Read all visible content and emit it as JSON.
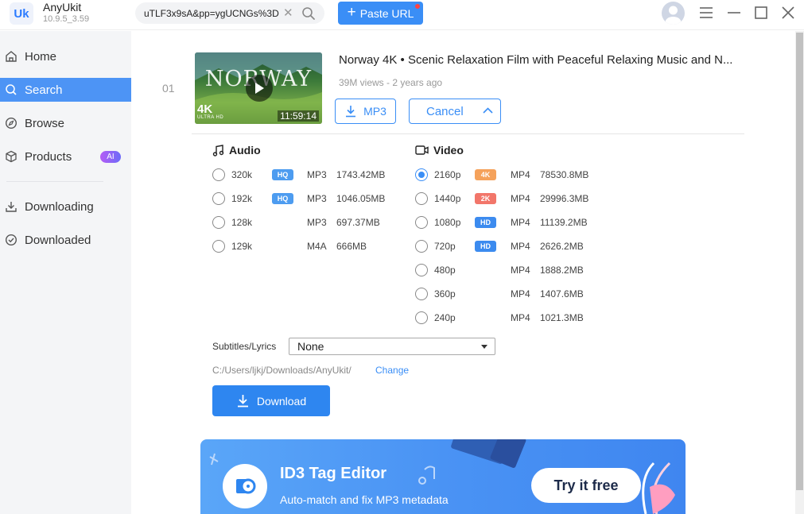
{
  "app": {
    "name": "AnyUkit",
    "version": "10.9.5_3.59",
    "logo_text": "Uk"
  },
  "toolbar": {
    "url_value": "uTLF3x9sA&pp=ygUCNGs%3D",
    "paste_label": "Paste URL"
  },
  "sidebar": {
    "items": [
      {
        "label": "Home",
        "icon": "home-icon"
      },
      {
        "label": "Search",
        "icon": "search-icon",
        "active": true
      },
      {
        "label": "Browse",
        "icon": "compass-icon"
      },
      {
        "label": "Products",
        "icon": "box-icon",
        "badge": "AI"
      },
      {
        "label": "Downloading",
        "icon": "download-icon"
      },
      {
        "label": "Downloaded",
        "icon": "check-circle-icon"
      }
    ]
  },
  "result": {
    "index": "01",
    "thumbnail": {
      "overlay_title": "NORWAY",
      "badge": "4K",
      "badge_sub": "ULTRA HD",
      "duration": "11:59:14"
    },
    "title": "Norway 4K • Scenic Relaxation Film with Peaceful Relaxing Music and N...",
    "meta": "39M views - 2 years ago",
    "mp3_label": "MP3",
    "cancel_label": "Cancel"
  },
  "audio": {
    "title": "Audio",
    "options": [
      {
        "quality": "320k",
        "badge": "HQ",
        "format": "MP3",
        "size": "1743.42MB",
        "checked": false
      },
      {
        "quality": "192k",
        "badge": "HQ",
        "format": "MP3",
        "size": "1046.05MB",
        "checked": false
      },
      {
        "quality": "128k",
        "badge": "",
        "format": "MP3",
        "size": "697.37MB",
        "checked": false
      },
      {
        "quality": "129k",
        "badge": "",
        "format": "M4A",
        "size": "666MB",
        "checked": false
      }
    ]
  },
  "video": {
    "title": "Video",
    "options": [
      {
        "quality": "2160p",
        "badge": "4K",
        "format": "MP4",
        "size": "78530.8MB",
        "checked": true
      },
      {
        "quality": "1440p",
        "badge": "2K",
        "format": "MP4",
        "size": "29996.3MB",
        "checked": false
      },
      {
        "quality": "1080p",
        "badge": "HD",
        "format": "MP4",
        "size": "11139.2MB",
        "checked": false
      },
      {
        "quality": "720p",
        "badge": "HD",
        "format": "MP4",
        "size": "2626.2MB",
        "checked": false
      },
      {
        "quality": "480p",
        "badge": "",
        "format": "MP4",
        "size": "1888.2MB",
        "checked": false
      },
      {
        "quality": "360p",
        "badge": "",
        "format": "MP4",
        "size": "1407.6MB",
        "checked": false
      },
      {
        "quality": "240p",
        "badge": "",
        "format": "MP4",
        "size": "1021.3MB",
        "checked": false
      }
    ]
  },
  "badge_colors": {
    "HQ": "#4d9cf0",
    "4K": "#f5a25b",
    "2K": "#f2766a",
    "HD": "#3c8bef"
  },
  "subtitles": {
    "label": "Subtitles/Lyrics",
    "value": "None"
  },
  "save_path": {
    "path": "C:/Users/ljkj/Downloads/AnyUkit/",
    "change_label": "Change"
  },
  "download_label": "Download",
  "banner": {
    "title": "ID3 Tag Editor",
    "subtitle": "Auto-match and fix MP3 metadata",
    "cta": "Try it free"
  },
  "colors": {
    "accent": "#3a8ef6",
    "sidebar_active": "#4d94f5"
  }
}
